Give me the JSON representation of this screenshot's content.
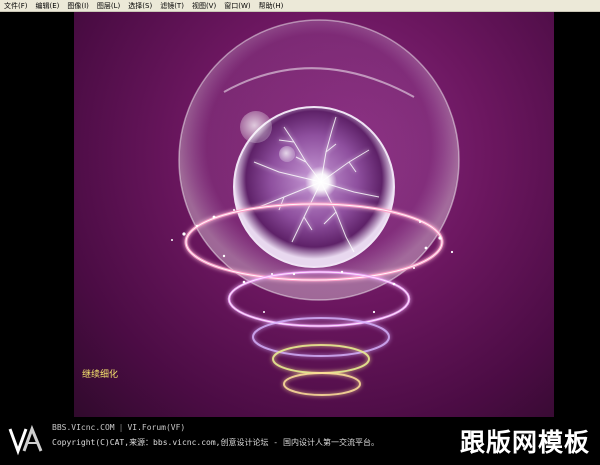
{
  "menu": {
    "items": [
      "文件(F)",
      "编辑(E)",
      "图像(I)",
      "图层(L)",
      "选择(S)",
      "滤镜(T)",
      "视图(V)",
      "窗口(W)",
      "帮助(H)"
    ]
  },
  "canvas": {
    "caption": "继续细化"
  },
  "footer": {
    "site": "BBS.VIcnc.COM",
    "separator": "|",
    "forum": "VI.Forum(VF)",
    "copyright": "Copyright(C)CAT,来源：bbs.vicnc.com,创意设计论坛 - 国内设计人第一交流平台。",
    "brand": "跟版网模板"
  },
  "colors": {
    "menubar_bg": "#ECE9D8",
    "caption": "#f5e36d",
    "canvas_bg": "#6c1760"
  }
}
